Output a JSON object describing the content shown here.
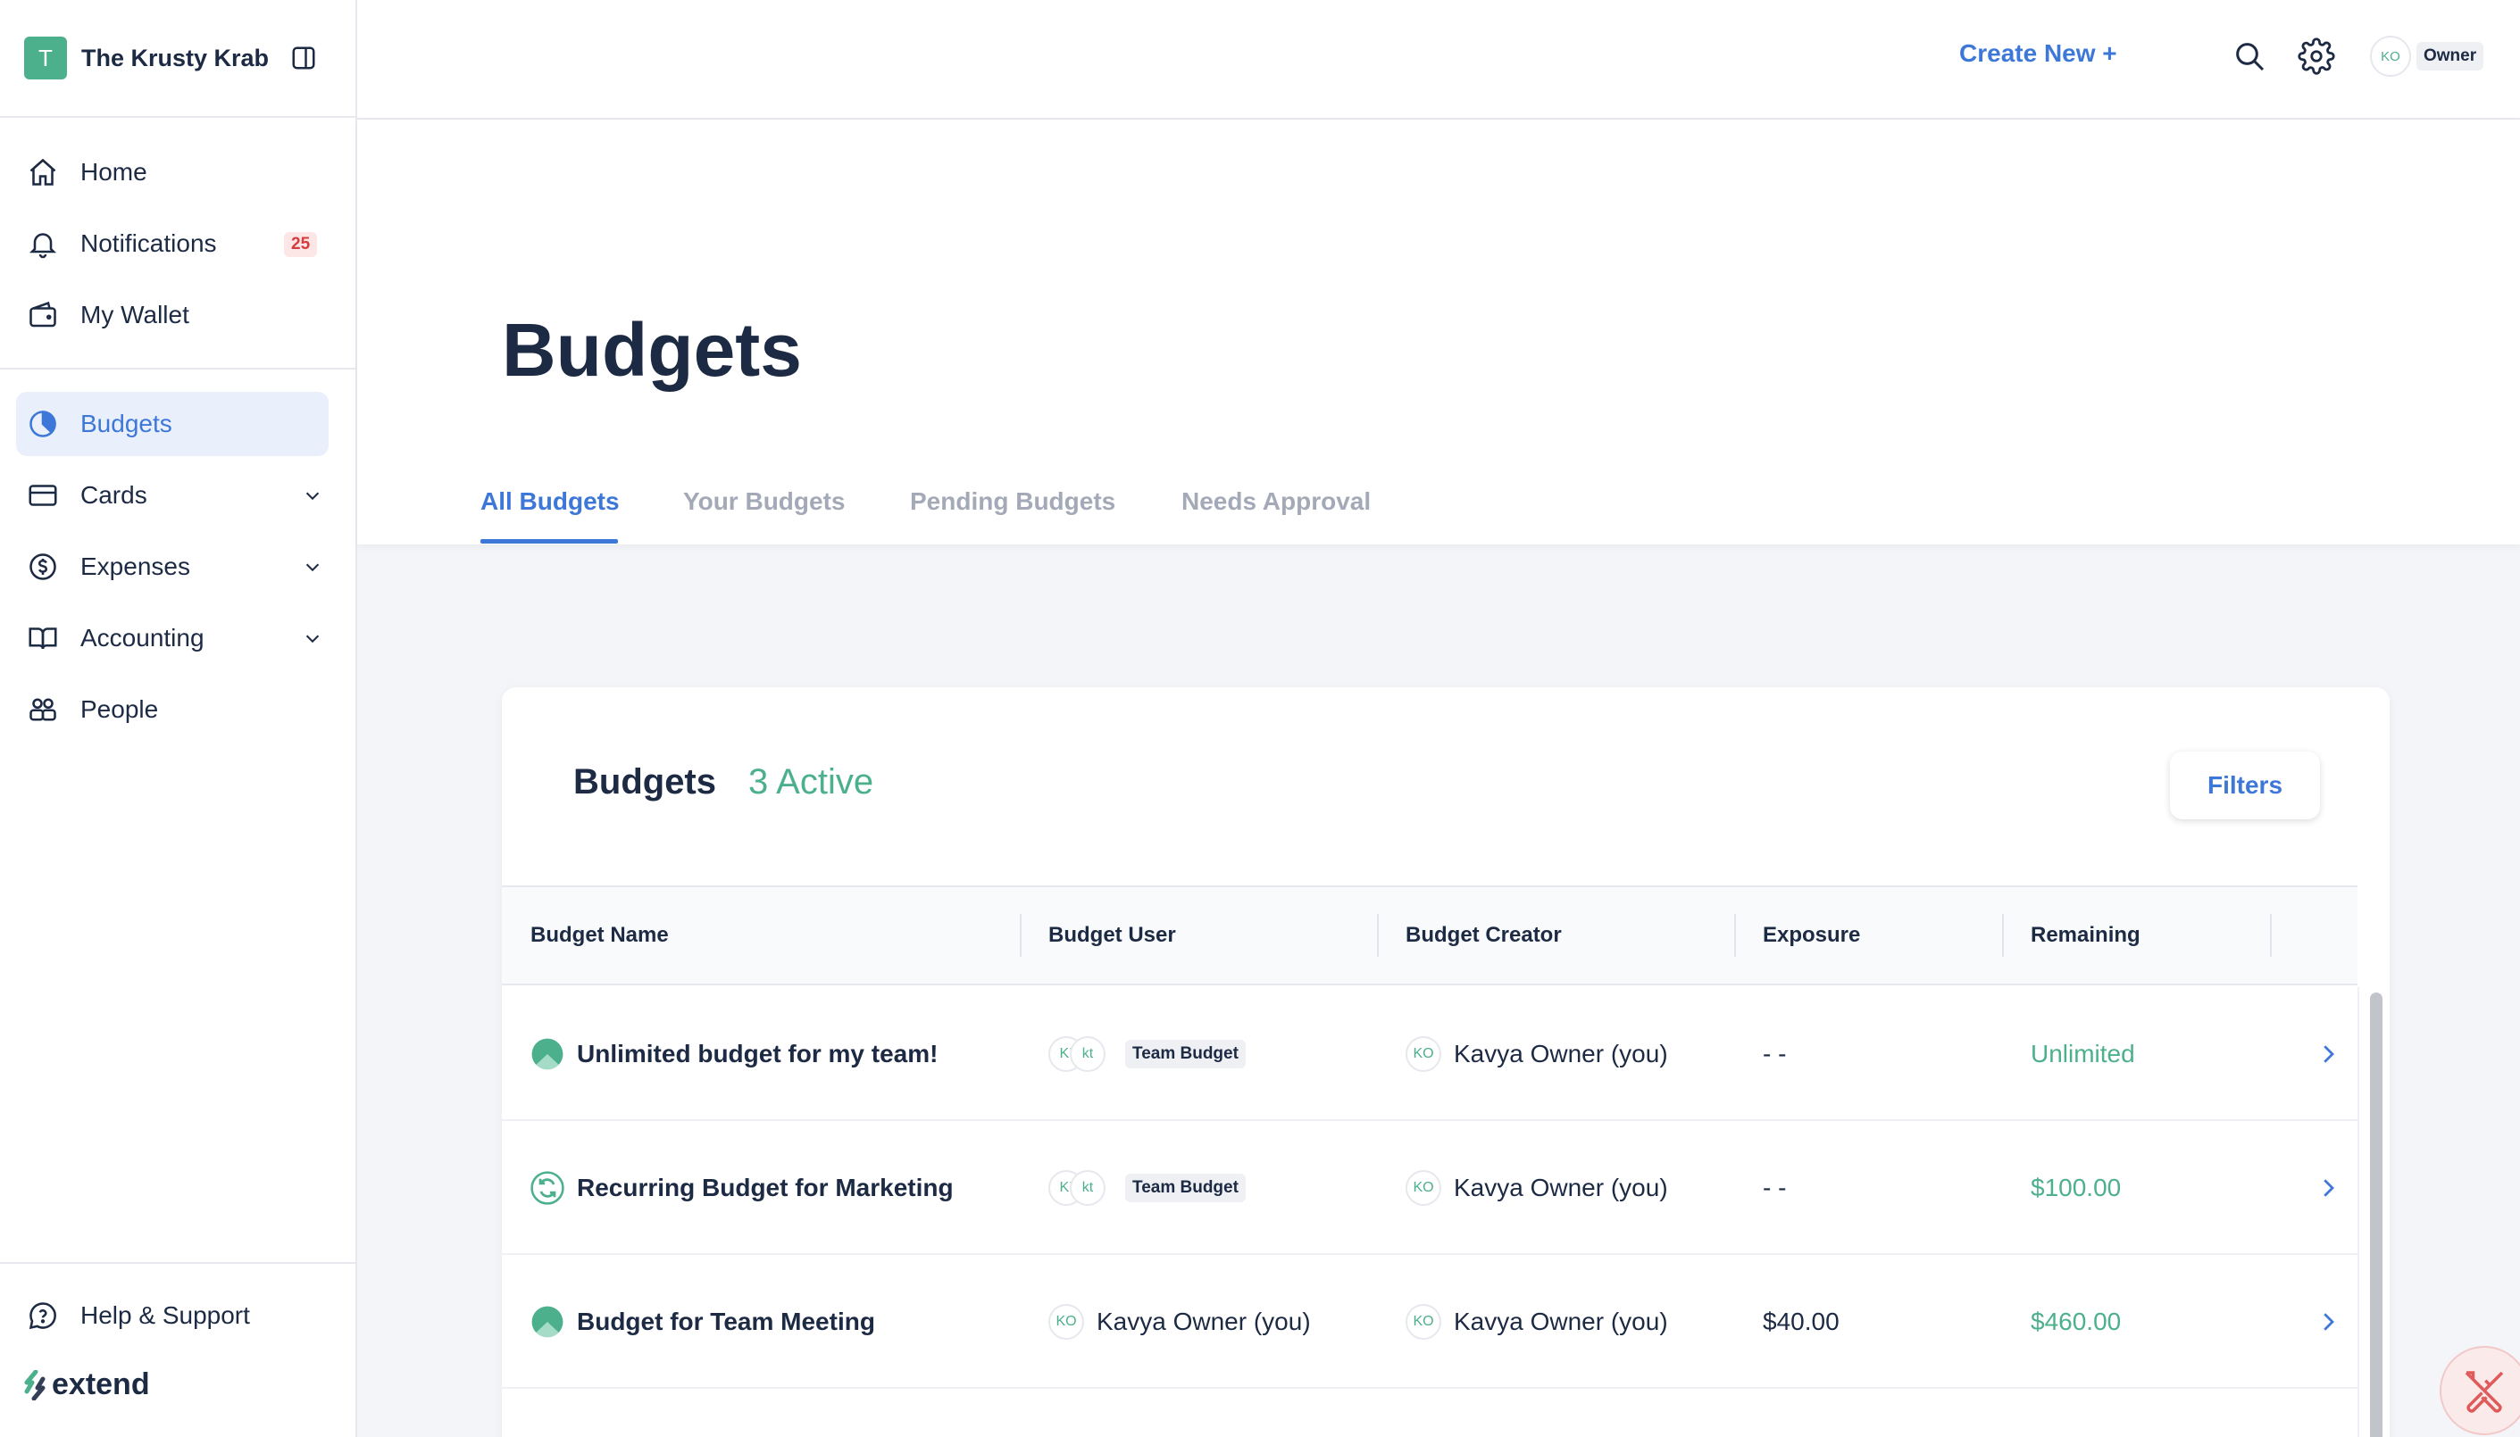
{
  "org": {
    "initial": "T",
    "name": "The Krusty Krab"
  },
  "nav": {
    "home": "Home",
    "notifications": "Notifications",
    "notifications_count": "25",
    "wallet": "My Wallet",
    "budgets": "Budgets",
    "cards": "Cards",
    "expenses": "Expenses",
    "accounting": "Accounting",
    "people": "People",
    "help": "Help & Support"
  },
  "logo": "extend",
  "topbar": {
    "create_new": "Create New +",
    "user_initials": "KO",
    "role": "Owner"
  },
  "page": {
    "title": "Budgets"
  },
  "tabs": [
    "All Budgets",
    "Your Budgets",
    "Pending Budgets",
    "Needs Approval"
  ],
  "card": {
    "title": "Budgets",
    "count": "3 Active",
    "filters": "Filters"
  },
  "table": {
    "columns": [
      "Budget Name",
      "Budget User",
      "Budget Creator",
      "Exposure",
      "Remaining"
    ],
    "rows": [
      {
        "name": "Unlimited budget for my team!",
        "user_avatars": [
          "KI",
          "kt"
        ],
        "user_label": "Team Budget",
        "creator_initials": "KO",
        "creator": "Kavya Owner (you)",
        "exposure": "- -",
        "remaining": "Unlimited"
      },
      {
        "name": "Recurring Budget for Marketing",
        "user_avatars": [
          "KI",
          "kt"
        ],
        "user_label": "Team Budget",
        "creator_initials": "KO",
        "creator": "Kavya Owner (you)",
        "exposure": "- -",
        "remaining": "$100.00"
      },
      {
        "name": "Budget for Team Meeting",
        "user_initials": "KO",
        "user_name": "Kavya Owner (you)",
        "creator_initials": "KO",
        "creator": "Kavya Owner (you)",
        "exposure": "$40.00",
        "remaining": "$460.00"
      }
    ]
  },
  "colors": {
    "accent": "#3d78d8",
    "green": "#4cb08c",
    "text": "#1d2a44",
    "badge_red": "#d43d3d"
  }
}
